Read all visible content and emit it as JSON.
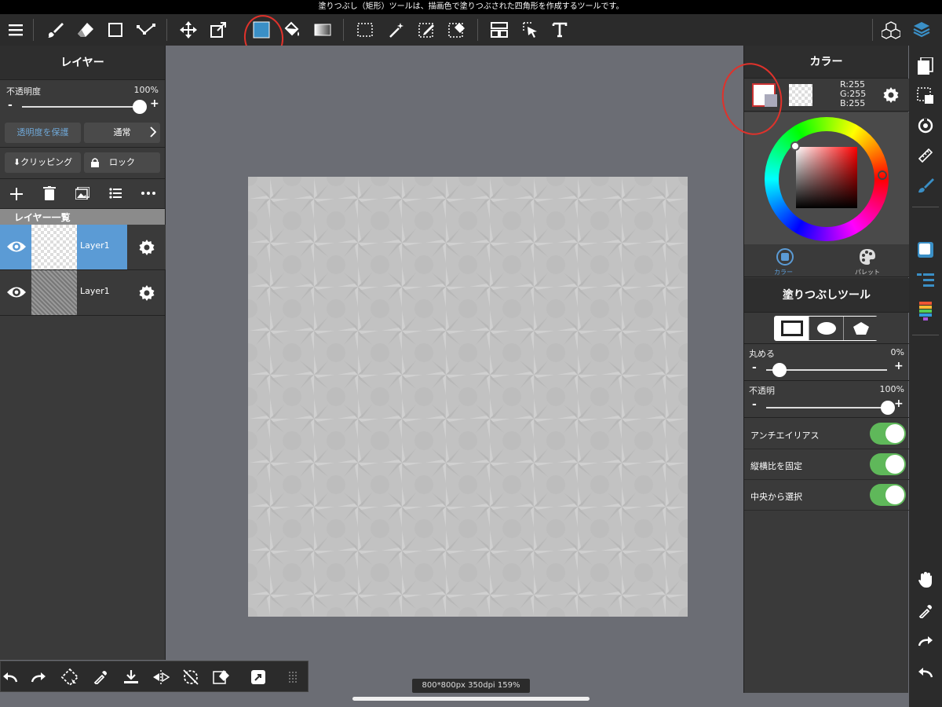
{
  "hint": "塗りつぶし（矩形）ツールは、描画色で塗りつぶされた四角形を作成するツールです。",
  "layers_panel": {
    "title": "レイヤー",
    "opacity_label": "不透明度",
    "opacity_value": "100%",
    "opacity_level": 1.0,
    "minus": "-",
    "plus": "+",
    "protect_alpha": "透明度を保護",
    "blend_mode": "通常",
    "clipping": "クリッピング",
    "lock": "ロック",
    "list_header": "レイヤー一覧",
    "layers": [
      {
        "name": "Layer1",
        "selected": true
      },
      {
        "name": "Layer1",
        "selected": false
      }
    ]
  },
  "color_panel": {
    "title": "カラー",
    "rgb": {
      "r": "R:255",
      "g": "G:255",
      "b": "B:255"
    },
    "tab_color": "カラー",
    "tab_palette": "パレット"
  },
  "fill_panel": {
    "title": "塗りつぶしツール",
    "round_label": "丸める",
    "round_value": "0%",
    "round_level": 0.0,
    "opacity_label": "不透明",
    "opacity_value": "100%",
    "opacity_level": 1.0,
    "minus": "-",
    "plus": "+",
    "antialias": "アンチエイリアス",
    "fix_aspect": "縦横比を固定",
    "from_center": "中央から選択"
  },
  "status": "800*800px 350dpi 159%",
  "colors": {
    "accent": "#5b9bd5",
    "toggle": "#5fb85a",
    "annotation": "#e0322b",
    "fill_color": "#3a8fc6"
  }
}
